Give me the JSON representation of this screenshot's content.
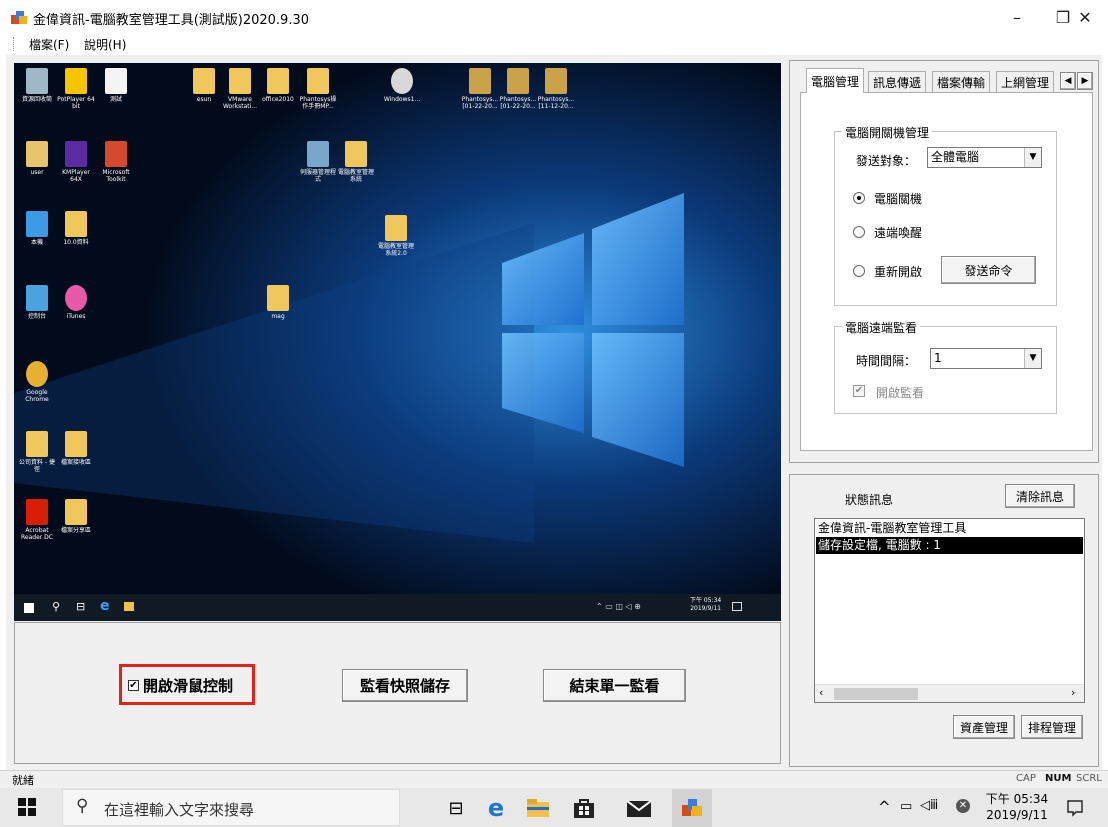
{
  "window": {
    "title": "金偉資訊-電腦教室管理工具(測試版)2020.9.30",
    "minimize_glyph": "–",
    "restore_glyph": "❐",
    "close_glyph": "✕"
  },
  "menu": {
    "file": "檔案(F)",
    "help": "說明(H)"
  },
  "preview": {
    "desktop_icons": [
      {
        "label": "資源回收筒",
        "icon": "recycle-bin-icon"
      },
      {
        "label": "PotPlayer 64 bit",
        "icon": "potplayer-icon"
      },
      {
        "label": "測試",
        "icon": "document-icon"
      },
      {
        "label": "esun",
        "icon": "folder-icon"
      },
      {
        "label": "VMware Workstati...",
        "icon": "folder-icon"
      },
      {
        "label": "office2010",
        "icon": "folder-icon"
      },
      {
        "label": "Phantosys操作手冊MP...",
        "icon": "folder-icon"
      },
      {
        "label": "Windows1...",
        "icon": "disc-icon"
      },
      {
        "label": "Phantosys... [01-22-20...",
        "icon": "archive-icon"
      },
      {
        "label": "Phantosys... [01-22-20...",
        "icon": "archive-icon"
      },
      {
        "label": "Phantosys... [11-12-20...",
        "icon": "archive-icon"
      },
      {
        "label": "user",
        "icon": "user-folder-icon"
      },
      {
        "label": "KMPlayer 64X",
        "icon": "kmplayer-icon"
      },
      {
        "label": "Microsoft Toolkit",
        "icon": "toolkit-icon"
      },
      {
        "label": "伺服器管理程式",
        "icon": "server-icon"
      },
      {
        "label": "電腦教室管理系統",
        "icon": "folder-icon"
      },
      {
        "label": "本機",
        "icon": "computer-icon"
      },
      {
        "label": "10.0資料",
        "icon": "folder-icon"
      },
      {
        "label": "電腦教室管理系統2.0",
        "icon": "folder-icon"
      },
      {
        "label": "控制台",
        "icon": "control-panel-icon"
      },
      {
        "label": "iTunes",
        "icon": "itunes-icon"
      },
      {
        "label": "mag",
        "icon": "folder-icon"
      },
      {
        "label": "Google Chrome",
        "icon": "chrome-icon"
      },
      {
        "label": "公司資料 - 捷徑",
        "icon": "folder-icon"
      },
      {
        "label": "檔案接收區",
        "icon": "folder-icon"
      },
      {
        "label": "Acrobat Reader DC",
        "icon": "acrobat-icon"
      },
      {
        "label": "檔案分享區",
        "icon": "folder-icon"
      }
    ],
    "taskbar_time": "下午 05:34",
    "taskbar_date": "2019/9/11"
  },
  "controls": {
    "mouse_control_label": "開啟滑鼠控制",
    "mouse_control_checked": true,
    "snapshot_button": "監看快照儲存",
    "end_monitor_button": "結束單一監看"
  },
  "tabs": [
    {
      "label": "電腦管理",
      "active": true
    },
    {
      "label": "訊息傳遞",
      "active": false
    },
    {
      "label": "檔案傳輸",
      "active": false
    },
    {
      "label": "上網管理",
      "active": false
    }
  ],
  "power": {
    "group_title": "電腦開關機管理",
    "target_label": "發送對象：",
    "target_value": "全體電腦",
    "options": [
      {
        "label": "電腦關機",
        "selected": true
      },
      {
        "label": "遠端喚醒",
        "selected": false
      },
      {
        "label": "重新開啟",
        "selected": false
      }
    ],
    "send_button": "發送命令"
  },
  "monitor": {
    "group_title": "電腦遠端監看",
    "interval_label": "時間間隔：",
    "interval_value": "1",
    "enable_label": "開啟監看",
    "enable_checked": true
  },
  "status": {
    "title": "狀態訊息",
    "clear_button": "清除訊息",
    "log": [
      {
        "text": "金偉資訊-電腦教室管理工具",
        "selected": false
      },
      {
        "text": "儲存設定檔, 電腦數 : 1",
        "selected": true
      }
    ],
    "asset_button": "資產管理",
    "schedule_button": "排程管理"
  },
  "statusbar": {
    "text": "就緒",
    "cap": "CAP",
    "num": "NUM",
    "scrl": "SCRL"
  },
  "taskbar": {
    "search_placeholder": "在這裡輸入文字來搜尋",
    "time": "下午 05:34",
    "date": "2019/9/11"
  }
}
